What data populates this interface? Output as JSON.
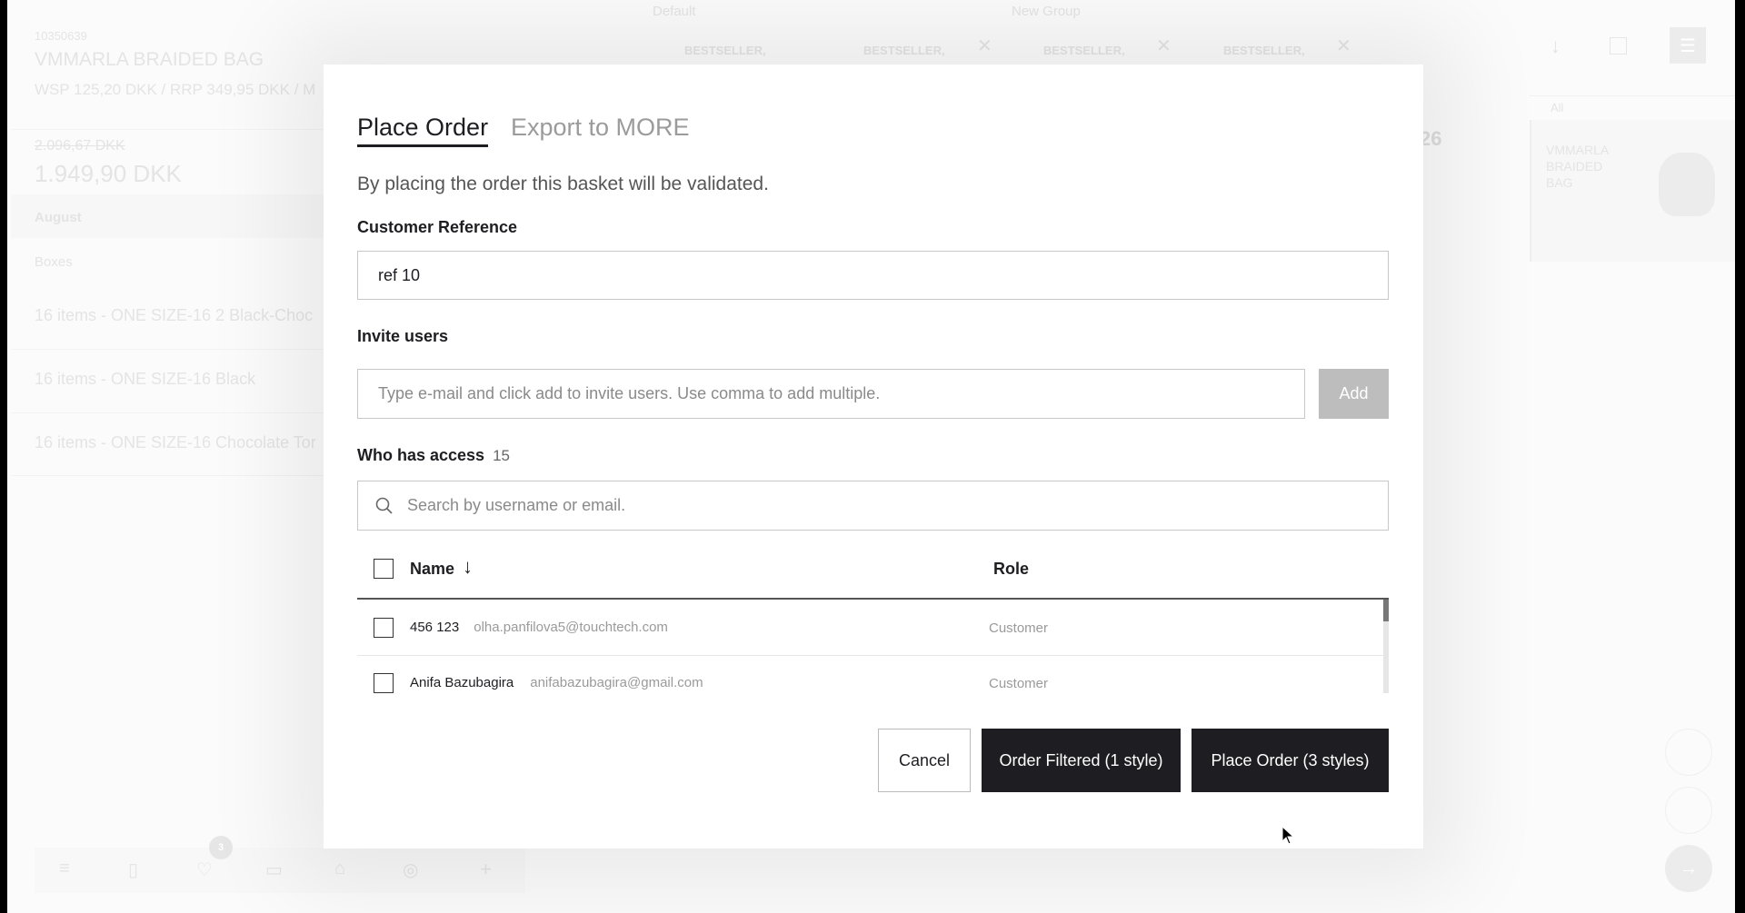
{
  "background": {
    "product_id": "10350639",
    "product_name": "VMMARLA BRAIDED BAG",
    "price_line": "WSP 125,20 DKK / RRP 349,95 DKK / M",
    "old_price": "2.096,67 DKK",
    "price": "1.949,90 DKK",
    "month": "August",
    "boxes_label": "Boxes",
    "items": [
      "16 items - ONE SIZE-16 2 Black-Choc",
      "16 items - ONE SIZE-16 Black",
      "16 items - ONE SIZE-16 Chocolate Tor"
    ],
    "groups": [
      "Default",
      "New Group"
    ],
    "columns": [
      "BESTSELLER,",
      "BESTSELLER,",
      "BESTSELLER,",
      "BESTSELLER,"
    ],
    "partial_number": "26",
    "filter_all": "All",
    "card_title": "VMMARLA BRAIDED BAG",
    "badge_count": "3"
  },
  "modal": {
    "tabs": [
      {
        "label": "Place Order",
        "active": true
      },
      {
        "label": "Export to MORE",
        "active": false
      }
    ],
    "description": "By placing the order this basket will be validated.",
    "customer_reference": {
      "label": "Customer Reference",
      "value": "ref 10"
    },
    "invite": {
      "label": "Invite users",
      "placeholder": "Type e-mail and click add to invite users. Use comma to add multiple.",
      "add_label": "Add"
    },
    "access": {
      "label": "Who has access",
      "count": "15",
      "search_placeholder": "Search by username or email."
    },
    "table": {
      "headers": {
        "name": "Name",
        "role": "Role"
      },
      "rows": [
        {
          "name": "456 123",
          "email": "olha.panfilova5@touchtech.com",
          "role": "Customer"
        },
        {
          "name": "Anifa Bazubagira",
          "email": "anifabazubagira@gmail.com",
          "role": "Customer"
        }
      ]
    },
    "buttons": {
      "cancel": "Cancel",
      "order_filtered": "Order Filtered (1 style)",
      "place_order": "Place Order (3 styles)"
    }
  },
  "colors": {
    "primary_button": "#1e1e22",
    "add_button": "#bdbdbd"
  }
}
